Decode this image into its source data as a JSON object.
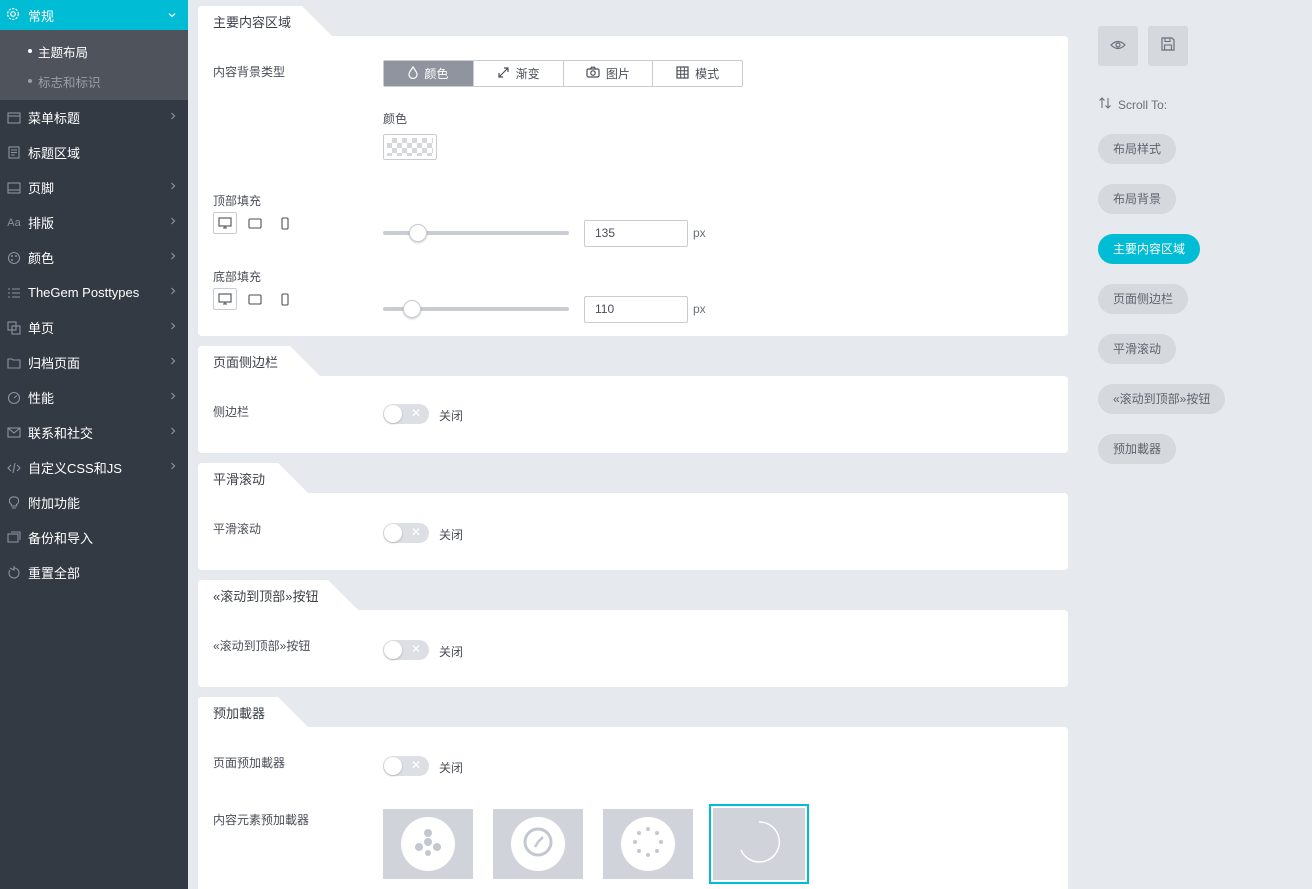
{
  "sidebar": {
    "active": {
      "label": "常规",
      "icon": "gear-icon"
    },
    "sub_items": [
      {
        "label": "主题布局",
        "current": true
      },
      {
        "label": "标志和标识",
        "current": false
      }
    ],
    "items": [
      {
        "label": "菜单标题",
        "icon": "window-icon",
        "has_chevron": true
      },
      {
        "label": "标题区域",
        "icon": "document-icon",
        "has_chevron": false
      },
      {
        "label": "页脚",
        "icon": "footer-icon",
        "has_chevron": true
      },
      {
        "label": "排版",
        "icon": "typography-icon",
        "icon_text": "Aa",
        "has_chevron": true
      },
      {
        "label": "颜色",
        "icon": "palette-icon",
        "has_chevron": true
      },
      {
        "label": "TheGem Posttypes",
        "icon": "list-icon",
        "has_chevron": true
      },
      {
        "label": "单页",
        "icon": "pages-icon",
        "has_chevron": true
      },
      {
        "label": "归档页面",
        "icon": "archive-icon",
        "has_chevron": true
      },
      {
        "label": "性能",
        "icon": "gauge-icon",
        "has_chevron": true
      },
      {
        "label": "联系和社交",
        "icon": "mail-icon",
        "has_chevron": true
      },
      {
        "label": "自定义CSS和JS",
        "icon": "code-icon",
        "has_chevron": true
      },
      {
        "label": "附加功能",
        "icon": "bulb-icon",
        "has_chevron": false
      },
      {
        "label": "备份和导入",
        "icon": "backup-icon",
        "has_chevron": false
      },
      {
        "label": "重置全部",
        "icon": "reset-icon",
        "has_chevron": false
      }
    ]
  },
  "sections": {
    "main_content": {
      "title": "主要内容区域",
      "bg_type_label": "内容背景类型",
      "bg_options": [
        {
          "label": "颜色",
          "icon": "drop-icon",
          "selected": true
        },
        {
          "label": "渐变",
          "icon": "gradient-icon",
          "selected": false
        },
        {
          "label": "图片",
          "icon": "camera-icon",
          "selected": false
        },
        {
          "label": "模式",
          "icon": "pattern-icon",
          "selected": false
        }
      ],
      "color_label": "颜色",
      "top_padding": {
        "label": "顶部填充",
        "value": "135",
        "unit": "px",
        "slider_fraction": 0.14
      },
      "bottom_padding": {
        "label": "底部填充",
        "value": "110",
        "unit": "px",
        "slider_fraction": 0.11
      }
    },
    "sidebar": {
      "title": "页面侧边栏",
      "label": "侧边栏",
      "state": "关闭"
    },
    "smooth_scroll": {
      "title": "平滑滚动",
      "label": "平滑滚动",
      "state": "关闭"
    },
    "scroll_top": {
      "title": "«滚动到顶部»按钮",
      "label": "«滚动到顶部»按钮",
      "state": "关闭"
    },
    "preloader": {
      "title": "预加載器",
      "page_label": "页面预加載器",
      "page_state": "关闭",
      "content_label": "内容元素预加載器",
      "styles": [
        "preloader-style-1-icon",
        "preloader-style-2-icon",
        "preloader-style-3-icon",
        "preloader-style-4-icon"
      ],
      "selected_index": 3
    }
  },
  "right": {
    "scroll_to_label": "Scroll To:",
    "links": [
      {
        "label": "布局样式",
        "active": false
      },
      {
        "label": "布局背景",
        "active": false
      },
      {
        "label": "主要内容区域",
        "active": true
      },
      {
        "label": "页面侧边栏",
        "active": false
      },
      {
        "label": "平滑滚动",
        "active": false
      },
      {
        "label": "«滚动到顶部»按钮",
        "active": false
      },
      {
        "label": "预加載器",
        "active": false
      }
    ]
  },
  "colors": {
    "accent": "#00bcd4",
    "sidebar_bg": "#343a43",
    "page_bg": "#e6e9ed"
  }
}
